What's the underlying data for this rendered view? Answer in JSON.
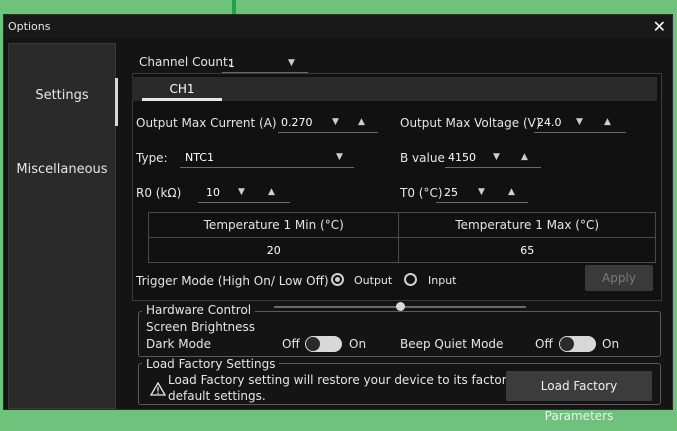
{
  "window": {
    "title": "Options",
    "close_icon": "✕"
  },
  "sidebar": {
    "items": [
      {
        "label": "Settings",
        "active": true
      },
      {
        "label": "Miscellaneous",
        "active": false
      }
    ]
  },
  "channel": {
    "label": "Channel Count:",
    "value": "1"
  },
  "tabs": [
    {
      "label": "CH1"
    }
  ],
  "ch1": {
    "max_current": {
      "label": "Output Max Current (A)",
      "value": "0.270"
    },
    "max_voltage": {
      "label": "Output Max Voltage (V)",
      "value": "24.0"
    },
    "type": {
      "label": "Type:",
      "value": "NTC1"
    },
    "b_value": {
      "label": "B value",
      "value": "4150"
    },
    "r0": {
      "label": "R0 (kΩ)",
      "value": "10"
    },
    "t0": {
      "label": "T0 (°C)",
      "value": "25"
    },
    "temp_table": {
      "headers": [
        "Temperature 1 Min (°C)",
        "Temperature 1 Max (°C)"
      ],
      "values": [
        "20",
        "65"
      ]
    },
    "trigger": {
      "label": "Trigger Mode (High On/ Low Off)",
      "options": [
        "Output",
        "Input"
      ],
      "selected": "Output"
    },
    "apply_label": "Apply"
  },
  "hardware": {
    "legend": "Hardware Control",
    "screen_brightness": {
      "label": "Screen Brightness",
      "level": 0.5
    },
    "dark_mode": {
      "label": "Dark Mode",
      "off": "Off",
      "on": "On",
      "state": "off"
    },
    "beep_quiet": {
      "label": "Beep Quiet Mode",
      "off": "Off",
      "on": "On",
      "state": "off"
    }
  },
  "factory": {
    "legend": "Load Factory Settings",
    "warning_line1": "Load Factory setting will restore your device to its factory",
    "warning_line2": "default settings.",
    "button_label": "Load Factory Parameters"
  },
  "colors": {
    "accent": "#24a148",
    "background": "#141414",
    "border_green": "#6ec27b"
  }
}
